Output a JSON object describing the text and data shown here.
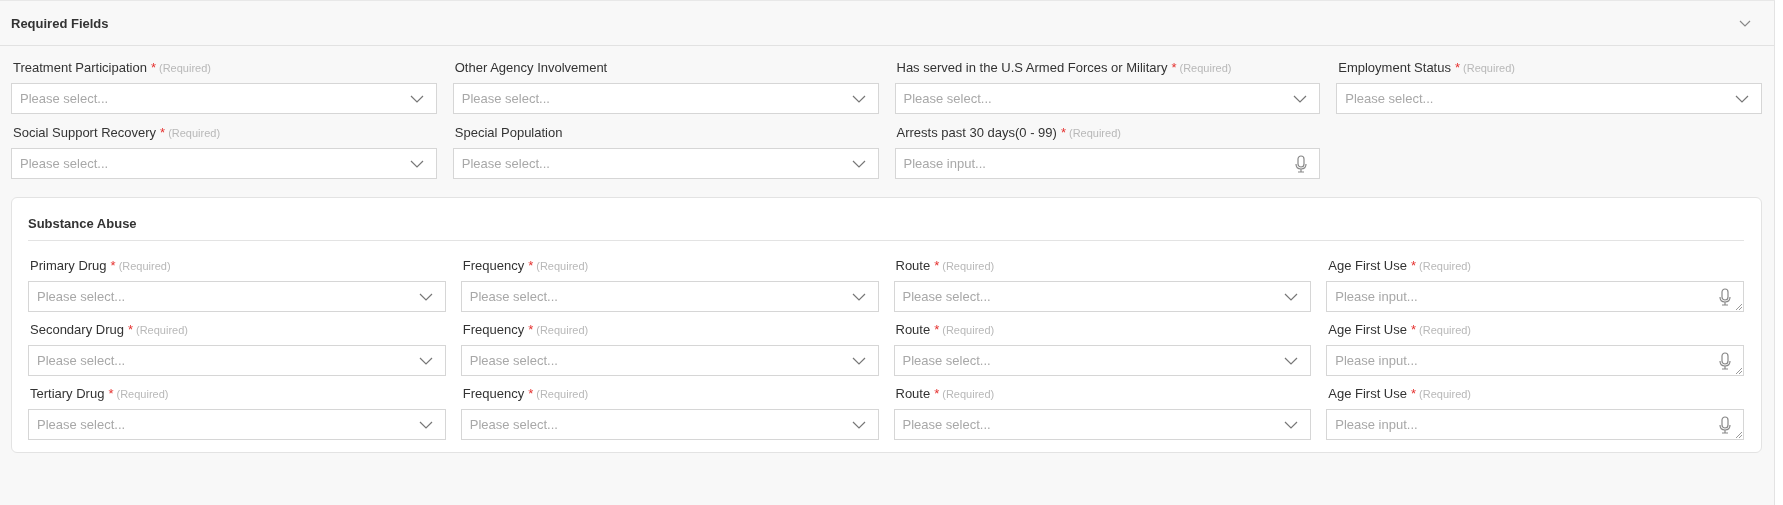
{
  "section": {
    "title": "Required Fields",
    "expanded": true,
    "fields": [
      {
        "label": "Treatment Participation",
        "mark": "*",
        "note": "(Required)",
        "kind": "select",
        "placeholder": "Please select..."
      },
      {
        "label": "Other Agency Involvement",
        "kind": "select",
        "placeholder": "Please select..."
      },
      {
        "label": "Has served in the U.S Armed Forces or Military",
        "mark": "*",
        "note": "(Required)",
        "kind": "select",
        "placeholder": "Please select..."
      },
      {
        "label": "Employment Status",
        "mark": "*",
        "note": "(Required)",
        "kind": "select",
        "placeholder": "Please select..."
      },
      {
        "label": "Social Support Recovery",
        "mark": "*",
        "note": "(Required)",
        "kind": "select",
        "placeholder": "Please select..."
      },
      {
        "label": "Special Population",
        "kind": "select",
        "placeholder": "Please select..."
      },
      {
        "label": "Arrests past 30 days(0 - 99)",
        "mark": "*",
        "note": "(Required)",
        "kind": "input",
        "placeholder": "Please input..."
      }
    ]
  },
  "substance_abuse": {
    "title": "Substance Abuse",
    "fields": [
      {
        "label": "Primary Drug",
        "mark": "*",
        "note": "(Required)",
        "kind": "select",
        "placeholder": "Please select..."
      },
      {
        "label": "Frequency",
        "mark": "*",
        "note": "(Required)",
        "kind": "select",
        "placeholder": "Please select..."
      },
      {
        "label": "Route",
        "mark": "*",
        "note": "(Required)",
        "kind": "select",
        "placeholder": "Please select..."
      },
      {
        "label": "Age First Use",
        "mark": "*",
        "note": "(Required)",
        "kind": "textarea",
        "placeholder": "Please input..."
      },
      {
        "label": "Secondary Drug",
        "mark": "*",
        "note": "(Required)",
        "kind": "select",
        "placeholder": "Please select..."
      },
      {
        "label": "Frequency",
        "mark": "*",
        "note": "(Required)",
        "kind": "select",
        "placeholder": "Please select..."
      },
      {
        "label": "Route",
        "mark": "*",
        "note": "(Required)",
        "kind": "select",
        "placeholder": "Please select..."
      },
      {
        "label": "Age First Use",
        "mark": "*",
        "note": "(Required)",
        "kind": "textarea",
        "placeholder": "Please input..."
      },
      {
        "label": "Tertiary Drug",
        "mark": "*",
        "note": "(Required)",
        "kind": "select",
        "placeholder": "Please select..."
      },
      {
        "label": "Frequency",
        "mark": "*",
        "note": "(Required)",
        "kind": "select",
        "placeholder": "Please select..."
      },
      {
        "label": "Route",
        "mark": "*",
        "note": "(Required)",
        "kind": "select",
        "placeholder": "Please select..."
      },
      {
        "label": "Age First Use",
        "mark": "*",
        "note": "(Required)",
        "kind": "textarea",
        "placeholder": "Please input..."
      }
    ]
  }
}
